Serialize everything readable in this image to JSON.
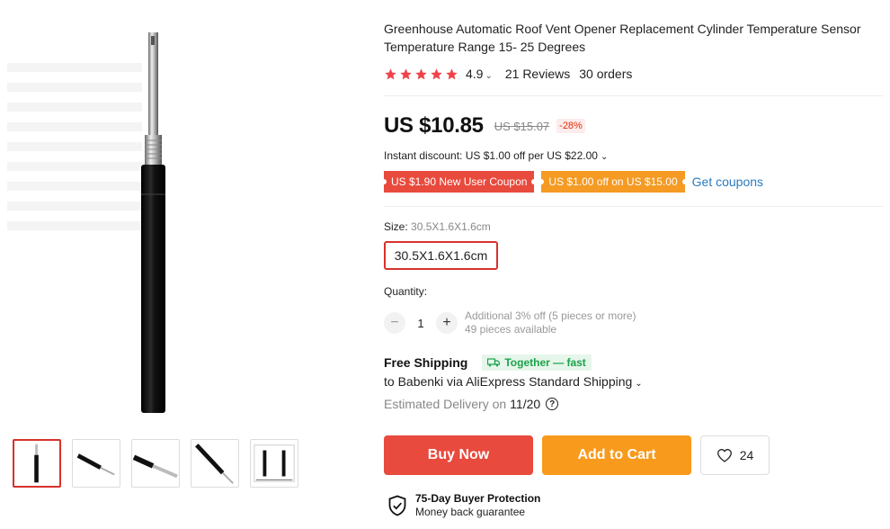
{
  "gallery": {
    "thumbnails": [
      {
        "name": "thumb-1",
        "active": true
      },
      {
        "name": "thumb-2",
        "active": false
      },
      {
        "name": "thumb-3",
        "active": false
      },
      {
        "name": "thumb-4",
        "active": false
      },
      {
        "name": "thumb-5",
        "active": false
      }
    ]
  },
  "product": {
    "title": "Greenhouse Automatic Roof Vent Opener Replacement Cylinder Temperature Sensor Temperature Range 15- 25 Degrees",
    "rating": "4.9",
    "rating_stars": 5,
    "reviews": "21 Reviews",
    "orders": "30 orders",
    "price": "US $10.85",
    "original_price": "US $15.07",
    "discount": "-28%",
    "instant_discount": "Instant discount: US $1.00 off per US $22.00",
    "coupon_new_user": "US $1.90 New User Coupon",
    "coupon_store": "US $1.00 off on US $15.00",
    "get_coupons": "Get coupons"
  },
  "options": {
    "size_label": "Size:",
    "size_selected": "30.5X1.6X1.6cm",
    "size_option": "30.5X1.6X1.6cm"
  },
  "quantity": {
    "label": "Quantity:",
    "value": "1",
    "minus": "−",
    "plus": "+",
    "additional": "Additional 3% off (5 pieces or more)",
    "available": "49 pieces available"
  },
  "shipping": {
    "title": "Free Shipping",
    "together_badge": "Together — fast",
    "to": "to Babenki via AliExpress Standard Shipping",
    "estimated_label": "Estimated Delivery on",
    "estimated_date": "11/20",
    "help": "?"
  },
  "actions": {
    "buy_now": "Buy Now",
    "add_to_cart": "Add to Cart",
    "wishlist_count": "24"
  },
  "protection": {
    "title": "75-Day Buyer Protection",
    "subtitle": "Money back guarantee"
  },
  "colors": {
    "accent_red": "#e84a3d",
    "accent_orange": "#f89a1c",
    "link_blue": "#2a7bbf",
    "star": "#f0424a",
    "green": "#1aa34a"
  }
}
